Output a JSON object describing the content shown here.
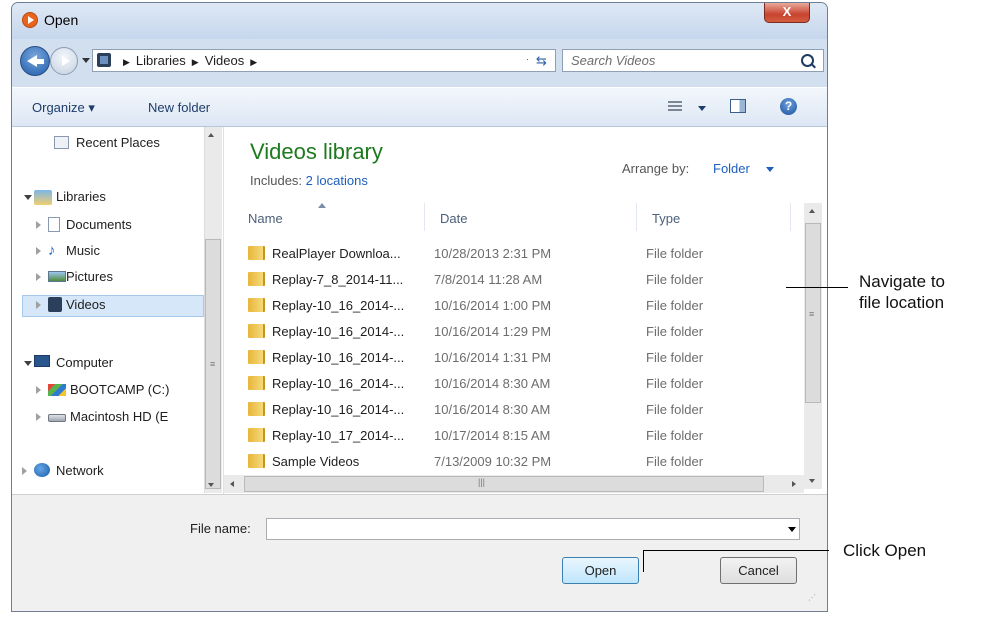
{
  "window": {
    "title": "Open",
    "close_label": "X"
  },
  "address": {
    "crumbs": [
      "Libraries",
      "Videos"
    ],
    "search_placeholder": "Search Videos"
  },
  "toolbar": {
    "organize": "Organize ▾",
    "new_folder": "New folder",
    "help": "?"
  },
  "nav": {
    "recent": "Recent Places",
    "libraries": "Libraries",
    "documents": "Documents",
    "music": "Music",
    "pictures": "Pictures",
    "videos": "Videos",
    "computer": "Computer",
    "bootcamp": "BOOTCAMP (C:)",
    "macintosh": "Macintosh HD (E",
    "network": "Network"
  },
  "library": {
    "title": "Videos library",
    "includes_label": "Includes:",
    "includes_link": "2 locations",
    "arrange_label": "Arrange by:",
    "arrange_value": "Folder"
  },
  "columns": {
    "name": "Name",
    "date": "Date",
    "type": "Type"
  },
  "files": [
    {
      "name": "RealPlayer Downloa...",
      "date": "10/28/2013 2:31 PM",
      "type": "File folder"
    },
    {
      "name": "Replay-7_8_2014-11...",
      "date": "7/8/2014 11:28 AM",
      "type": "File folder"
    },
    {
      "name": "Replay-10_16_2014-...",
      "date": "10/16/2014 1:00 PM",
      "type": "File folder"
    },
    {
      "name": "Replay-10_16_2014-...",
      "date": "10/16/2014 1:29 PM",
      "type": "File folder"
    },
    {
      "name": "Replay-10_16_2014-...",
      "date": "10/16/2014 1:31 PM",
      "type": "File folder"
    },
    {
      "name": "Replay-10_16_2014-...",
      "date": "10/16/2014 8:30 AM",
      "type": "File folder"
    },
    {
      "name": "Replay-10_16_2014-...",
      "date": "10/16/2014 8:30 AM",
      "type": "File folder"
    },
    {
      "name": "Replay-10_17_2014-...",
      "date": "10/17/2014 8:15 AM",
      "type": "File folder"
    },
    {
      "name": "Sample Videos",
      "date": "7/13/2009 10:32 PM",
      "type": "File folder"
    }
  ],
  "bottom": {
    "file_name_label": "File name:",
    "file_name_value": "",
    "open": "Open",
    "cancel": "Cancel"
  },
  "callouts": {
    "navigate": "Navigate to\nfile location",
    "open": "Click Open"
  },
  "colors": {
    "library_title": "#1e7a1e",
    "link": "#1e5fbb",
    "selection": "#d5e7f8"
  }
}
